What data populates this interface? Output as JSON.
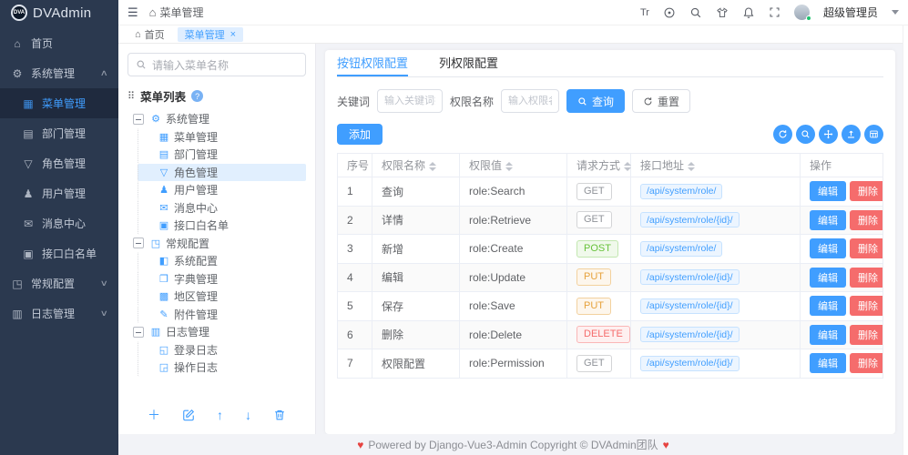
{
  "brand": {
    "logo_text": "DVA",
    "title": "DVAdmin"
  },
  "topbar": {
    "breadcrumb": "菜单管理",
    "language_icon_label": "Tr",
    "username": "超级管理员"
  },
  "tabstrip": {
    "tabs": [
      {
        "name": "home",
        "label": "首页",
        "active": false
      },
      {
        "name": "menu-management",
        "label": "菜单管理",
        "active": true
      }
    ],
    "close_glyph": "×"
  },
  "sidebar": {
    "items": [
      {
        "name": "home",
        "label": "首页",
        "icon": "home",
        "type": "item"
      },
      {
        "name": "system-management",
        "label": "系统管理",
        "icon": "gear",
        "type": "group",
        "expanded": true
      },
      {
        "name": "menu-management",
        "label": "菜单管理",
        "icon": "menu",
        "type": "sub",
        "active": true
      },
      {
        "name": "department-management",
        "label": "部门管理",
        "icon": "dept",
        "type": "sub"
      },
      {
        "name": "role-management",
        "label": "角色管理",
        "icon": "role",
        "type": "sub"
      },
      {
        "name": "user-management",
        "label": "用户管理",
        "icon": "user",
        "type": "sub"
      },
      {
        "name": "message-center",
        "label": "消息中心",
        "icon": "message",
        "type": "sub"
      },
      {
        "name": "api-whitelist",
        "label": "接口白名单",
        "icon": "api",
        "type": "sub"
      },
      {
        "name": "general-config",
        "label": "常规配置",
        "icon": "config",
        "type": "group",
        "expanded": false
      },
      {
        "name": "log-management",
        "label": "日志管理",
        "icon": "log",
        "type": "group",
        "expanded": false
      }
    ]
  },
  "tree_panel": {
    "search_placeholder": "请输入菜单名称",
    "title": "菜单列表",
    "help_glyph": "?",
    "items": [
      {
        "name": "system-management",
        "label": "系统管理",
        "icon": "gear",
        "level": 0,
        "expanded": true
      },
      {
        "name": "menu-management",
        "label": "菜单管理",
        "icon": "menu",
        "level": 1
      },
      {
        "name": "department-management",
        "label": "部门管理",
        "icon": "dept",
        "level": 1
      },
      {
        "name": "role-management",
        "label": "角色管理",
        "icon": "role",
        "level": 1,
        "selected": true
      },
      {
        "name": "user-management",
        "label": "用户管理",
        "icon": "user",
        "level": 1
      },
      {
        "name": "message-center",
        "label": "消息中心",
        "icon": "message",
        "level": 1
      },
      {
        "name": "api-whitelist",
        "label": "接口白名单",
        "icon": "api",
        "level": 1
      },
      {
        "name": "general-config",
        "label": "常规配置",
        "icon": "config",
        "level": 0,
        "expanded": true
      },
      {
        "name": "system-config",
        "label": "系统配置",
        "icon": "sys",
        "level": 1
      },
      {
        "name": "dict-management",
        "label": "字典管理",
        "icon": "dict",
        "level": 1
      },
      {
        "name": "area-management",
        "label": "地区管理",
        "icon": "area",
        "level": 1
      },
      {
        "name": "attachment-management",
        "label": "附件管理",
        "icon": "file",
        "level": 1
      },
      {
        "name": "log-management",
        "label": "日志管理",
        "icon": "log",
        "level": 0,
        "expanded": true
      },
      {
        "name": "login-log",
        "label": "登录日志",
        "icon": "loginlog",
        "level": 1
      },
      {
        "name": "operation-log",
        "label": "操作日志",
        "icon": "oplog",
        "level": 1
      }
    ]
  },
  "content": {
    "tabs": [
      {
        "name": "button-permission-config",
        "label": "按钮权限配置",
        "active": true
      },
      {
        "name": "column-permission-config",
        "label": "列权限配置",
        "active": false
      }
    ],
    "filters": {
      "keyword_label": "关键词",
      "keyword_placeholder": "输入关键词搜索",
      "name_label": "权限名称",
      "name_placeholder": "输入权限名称搜",
      "search_label": "查询",
      "reset_label": "重置"
    },
    "add_label": "添加",
    "table": {
      "headers": [
        {
          "label": "序号",
          "sortable": false
        },
        {
          "label": "权限名称",
          "sortable": true
        },
        {
          "label": "权限值",
          "sortable": true
        },
        {
          "label": "请求方式",
          "sortable": true
        },
        {
          "label": "接口地址",
          "sortable": true
        },
        {
          "label": "操作",
          "sortable": false
        }
      ],
      "rows": [
        {
          "no": "1",
          "name": "查询",
          "value": "role:Search",
          "method": "GET",
          "url": "/api/system/role/"
        },
        {
          "no": "2",
          "name": "详情",
          "value": "role:Retrieve",
          "method": "GET",
          "url": "/api/system/role/{id}/"
        },
        {
          "no": "3",
          "name": "新增",
          "value": "role:Create",
          "method": "POST",
          "url": "/api/system/role/"
        },
        {
          "no": "4",
          "name": "编辑",
          "value": "role:Update",
          "method": "PUT",
          "url": "/api/system/role/{id}/"
        },
        {
          "no": "5",
          "name": "保存",
          "value": "role:Save",
          "method": "PUT",
          "url": "/api/system/role/{id}/"
        },
        {
          "no": "6",
          "name": "删除",
          "value": "role:Delete",
          "method": "DELETE",
          "url": "/api/system/role/{id}/"
        },
        {
          "no": "7",
          "name": "权限配置",
          "value": "role:Permission",
          "method": "GET",
          "url": "/api/system/role/{id}/"
        }
      ],
      "edit_label": "编辑",
      "delete_label": "删除"
    }
  },
  "footer": {
    "heart_glyph": "♥",
    "text": "Powered by Django-Vue3-Admin Copyright © DVAdmin团队"
  },
  "icons_glyphs": {
    "home": "⌂",
    "hamburger": "☰",
    "gear": "⚙",
    "menu": "▦",
    "dept": "▤",
    "role": "▽",
    "user": "♟",
    "message": "✉",
    "api": "▣",
    "config": "◳",
    "log": "▥",
    "sys": "◧",
    "dict": "❐",
    "area": "▩",
    "file": "✎",
    "loginlog": "◱",
    "oplog": "◲",
    "grid": "⠿",
    "chevron_up": "∧",
    "chevron_down": "∨",
    "plus": "＋",
    "arrow_up": "↑",
    "arrow_down": "↓"
  },
  "colors": {
    "primary": "#409eff",
    "danger": "#f56c6c",
    "success": "#67c23a",
    "warning": "#e6a23c",
    "info": "#909399",
    "sidebar_bg": "#2b394f",
    "sidebar_active_bg": "#1f2a3e",
    "online_dot": "#1fc26f"
  }
}
